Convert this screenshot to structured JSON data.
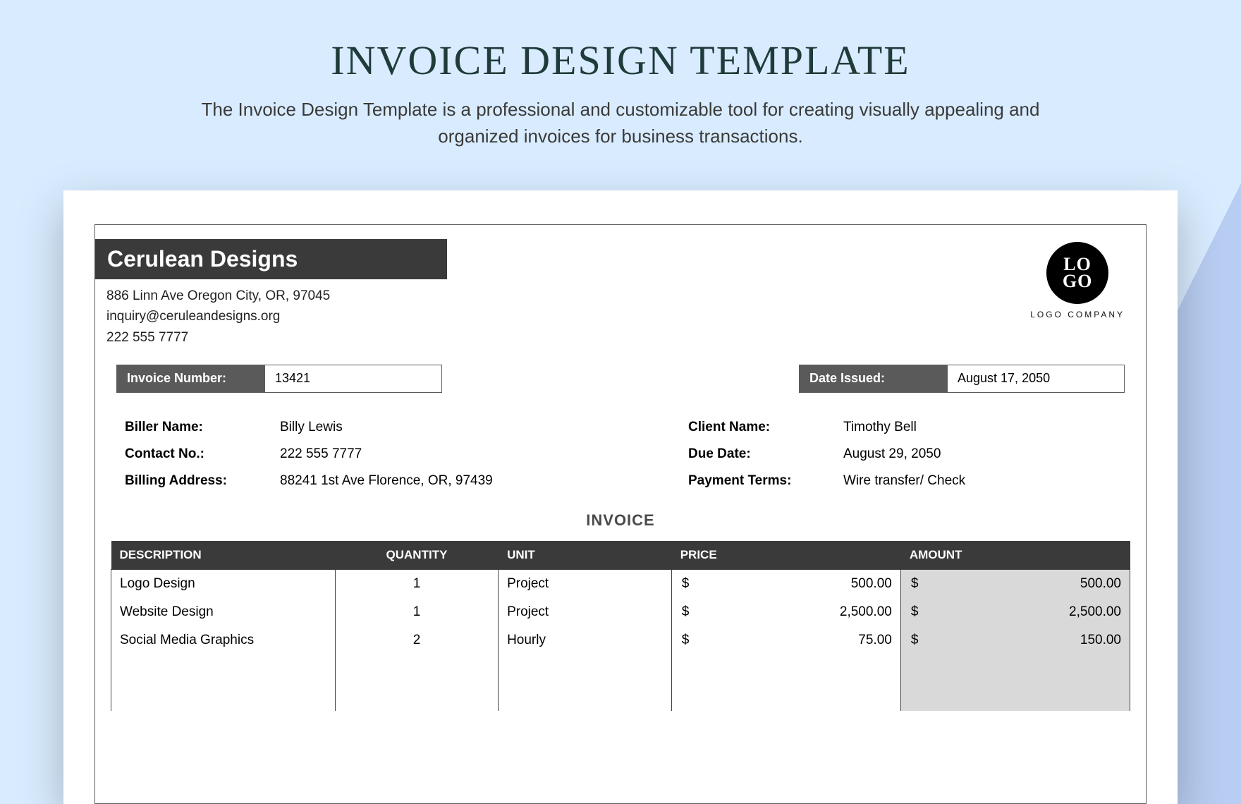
{
  "hero": {
    "title": "INVOICE DESIGN TEMPLATE",
    "subtitle": "The Invoice Design Template is a professional and customizable tool for creating visually appealing and organized invoices for business transactions."
  },
  "company": {
    "name": "Cerulean Designs",
    "address": "886 Linn Ave Oregon City, OR, 97045",
    "email": "inquiry@ceruleandesigns.org",
    "phone": "222 555 7777"
  },
  "logo": {
    "line1": "LO",
    "line2": "GO",
    "caption": "LOGO COMPANY"
  },
  "meta": {
    "invoice_number_label": "Invoice Number:",
    "invoice_number_value": "13421",
    "date_issued_label": "Date Issued:",
    "date_issued_value": "August 17, 2050"
  },
  "biller": {
    "name_label": "Biller Name:",
    "name_value": "Billy Lewis",
    "contact_label": "Contact No.:",
    "contact_value": "222 555 7777",
    "address_label": "Billing Address:",
    "address_value": "88241 1st Ave Florence, OR, 97439"
  },
  "client": {
    "name_label": "Client Name:",
    "name_value": "Timothy Bell",
    "due_label": "Due Date:",
    "due_value": "August 29, 2050",
    "terms_label": "Payment Terms:",
    "terms_value": "Wire transfer/ Check"
  },
  "invoice_heading": "INVOICE",
  "columns": {
    "description": "DESCRIPTION",
    "quantity": "QUANTITY",
    "unit": "UNIT",
    "price": "PRICE",
    "amount": "AMOUNT"
  },
  "currency": "$",
  "lines": [
    {
      "description": "Logo Design",
      "quantity": "1",
      "unit": "Project",
      "price": "500.00",
      "amount": "500.00"
    },
    {
      "description": "Website Design",
      "quantity": "1",
      "unit": "Project",
      "price": "2,500.00",
      "amount": "2,500.00"
    },
    {
      "description": "Social Media Graphics",
      "quantity": "2",
      "unit": "Hourly",
      "price": "75.00",
      "amount": "150.00"
    }
  ]
}
